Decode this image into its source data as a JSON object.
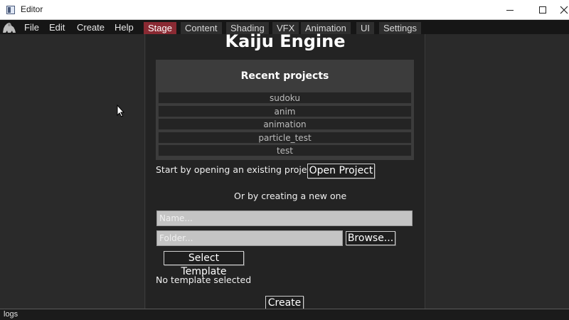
{
  "window": {
    "title": "Editor"
  },
  "menu": {
    "items": [
      "File",
      "Edit",
      "Create",
      "Help"
    ],
    "tabs": [
      "Stage",
      "Content",
      "Shading",
      "VFX",
      "Animation",
      "UI",
      "Settings"
    ],
    "active_tab": "Stage"
  },
  "main": {
    "heading": "Kaiju Engine",
    "recent": {
      "title": "Recent projects",
      "projects": [
        "sudoku",
        "anim",
        "animation",
        "particle_test",
        "test"
      ]
    },
    "open_prompt": "Start by opening an existing project:",
    "open_button": "Open Project",
    "new_prompt": "Or by creating a new one",
    "name_placeholder": "Name...",
    "folder_placeholder": "Folder...",
    "browse_button": "Browse...",
    "template_button": "Select Template",
    "template_status": "No template selected",
    "create_button": "Create"
  },
  "status": {
    "log_label": "logs"
  },
  "colors": {
    "accent": "#8a2a33",
    "background": "#2a2a2a",
    "panel": "#232323"
  }
}
